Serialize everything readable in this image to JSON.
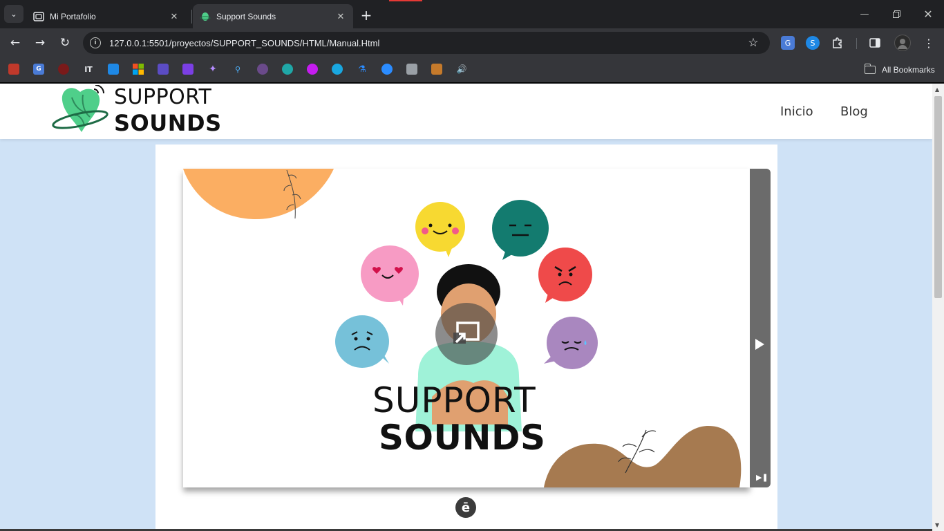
{
  "browser": {
    "tabs": [
      {
        "title": "Mi Portafolio",
        "active": false,
        "favicon": "portfolio-icon"
      },
      {
        "title": "Support Sounds",
        "active": true,
        "favicon": "support-sounds-icon"
      }
    ],
    "new_tab_symbol": "+",
    "url": "127.0.0.1:5501/proyectos/SUPPORT_SOUNDS/HTML/Manual.Html",
    "bookmarks_label": "All Bookmarks",
    "window_controls": [
      "minimize-icon",
      "restore-icon",
      "close-icon"
    ]
  },
  "site": {
    "logo_line1": "SUPPORT",
    "logo_line2": "SOUNDS",
    "nav": [
      {
        "label": "Inicio"
      },
      {
        "label": "Blog"
      }
    ]
  },
  "presentation": {
    "title_line1": "SUPPORT",
    "title_line2": "SOUNDS",
    "badge_letter": "ē",
    "emojis": [
      "happy-face-icon",
      "neutral-face-icon",
      "angry-face-icon",
      "love-face-icon",
      "sad-face-icon",
      "crying-face-icon"
    ]
  },
  "colors": {
    "page_bg": "#cfe2f6",
    "orange_blob": "#fbae62",
    "brown_blob": "#a67a50",
    "shirt": "#9ff2d8"
  }
}
